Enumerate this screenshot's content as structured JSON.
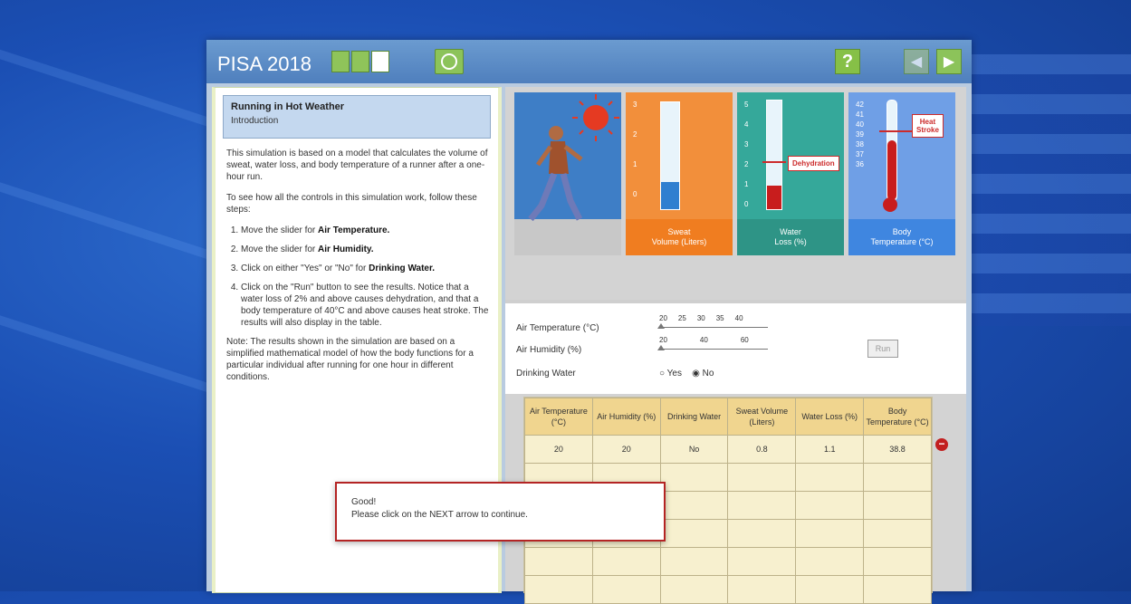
{
  "app": {
    "title": "PISA 2018",
    "progress_segments": 3,
    "progress_active_index": 2
  },
  "left_panel": {
    "title": "Running in Hot Weather",
    "subtitle": "Introduction",
    "para1": "This simulation is based on a model that calculates the volume of sweat, water loss, and body temperature of a runner after a one-hour run.",
    "para2": "To see how all the controls in this simulation work, follow these steps:",
    "steps": [
      {
        "pre": "Move the slider for ",
        "bold": "Air Temperature.",
        "post": ""
      },
      {
        "pre": "Move the slider for ",
        "bold": "Air Humidity.",
        "post": ""
      },
      {
        "pre": "Click on either \"Yes\" or \"No\" for ",
        "bold": "Drinking Water.",
        "post": ""
      },
      {
        "pre": "Click on the \"Run\" button to see the results. Notice that a water loss of 2% and above causes dehydration, and that a body temperature of 40°C and above causes heat stroke. The results will also display in the table.",
        "bold": "",
        "post": ""
      }
    ],
    "note": "Note: The results shown in the simulation are based on a simplified mathematical model of how the body functions for a particular individual after running for one hour in different conditions."
  },
  "tiles": {
    "sweat": {
      "label_line1": "Sweat",
      "label_line2": "Volume (Liters)",
      "scale": [
        "3",
        "2",
        "1",
        "0"
      ]
    },
    "water": {
      "label_line1": "Water",
      "label_line2": "Loss (%)",
      "scale": [
        "5",
        "4",
        "3",
        "2",
        "1",
        "0"
      ],
      "callout": "Dehydration"
    },
    "body": {
      "label_line1": "Body",
      "label_line2": "Temperature (°C)",
      "scale": [
        "42",
        "41",
        "40",
        "39",
        "38",
        "37",
        "36"
      ],
      "callout_line1": "Heat",
      "callout_line2": "Stroke"
    }
  },
  "controls": {
    "air_temperature_label": "Air Temperature (°C)",
    "air_temperature_ticks": [
      "20",
      "25",
      "30",
      "35",
      "40"
    ],
    "air_humidity_label": "Air Humidity (%)",
    "air_humidity_ticks": [
      "20",
      "40",
      "60"
    ],
    "drinking_water_label": "Drinking Water",
    "radio_yes": "Yes",
    "radio_no": "No",
    "run_label": "Run"
  },
  "table": {
    "headers": [
      "Air Temperature (°C)",
      "Air Humidity (%)",
      "Drinking Water",
      "Sweat Volume (Liters)",
      "Water Loss (%)",
      "Body Temperature (°C)"
    ],
    "rows": [
      [
        "20",
        "20",
        "No",
        "0.8",
        "1.1",
        "38.8"
      ]
    ]
  },
  "modal": {
    "line1": "Good!",
    "line2": "Please click on the NEXT arrow to continue."
  },
  "colors": {
    "sweat_tile": "#f28f3b",
    "water_tile": "#35a89a",
    "body_tile": "#6f9fe6",
    "alert": "#cc2b2b"
  },
  "icons": {
    "timer": "timer-icon",
    "help": "help-icon",
    "back": "back-arrow-icon",
    "next": "next-arrow-icon",
    "delete": "delete-row-icon"
  }
}
